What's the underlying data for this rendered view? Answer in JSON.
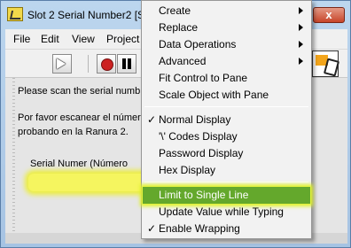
{
  "window": {
    "title": "Slot 2 Serial Number2 [Se",
    "close_symbol": "x"
  },
  "menubar": {
    "items": [
      "File",
      "Edit",
      "View",
      "Project"
    ]
  },
  "toolbar": {
    "icons": [
      "run-arrow-icon",
      "abort-icon",
      "pause-icon",
      "context-help-icon",
      "vi-icon"
    ]
  },
  "panel": {
    "line1": "Please scan the serial numb",
    "line2": "Por favor escanear el númer",
    "line3": "probando en la Ranura 2.",
    "field_label": "Serial Numer (Número"
  },
  "context_menu": {
    "items": [
      {
        "label": "Create",
        "submenu": true,
        "checked": false,
        "highlighted": false
      },
      {
        "label": "Replace",
        "submenu": true,
        "checked": false,
        "highlighted": false
      },
      {
        "label": "Data Operations",
        "submenu": true,
        "checked": false,
        "highlighted": false
      },
      {
        "label": "Advanced",
        "submenu": true,
        "checked": false,
        "highlighted": false
      },
      {
        "label": "Fit Control to Pane",
        "submenu": false,
        "checked": false,
        "highlighted": false
      },
      {
        "label": "Scale Object with Pane",
        "submenu": false,
        "checked": false,
        "highlighted": false
      },
      {
        "label": "Normal Display",
        "submenu": false,
        "checked": true,
        "highlighted": false
      },
      {
        "label": "'\\' Codes Display",
        "submenu": false,
        "checked": false,
        "highlighted": false
      },
      {
        "label": "Password Display",
        "submenu": false,
        "checked": false,
        "highlighted": false
      },
      {
        "label": "Hex Display",
        "submenu": false,
        "checked": false,
        "highlighted": false
      },
      {
        "label": "Limit to Single Line",
        "submenu": false,
        "checked": false,
        "highlighted": true
      },
      {
        "label": "Update Value while Typing",
        "submenu": false,
        "checked": false,
        "highlighted": false
      },
      {
        "label": "Enable Wrapping",
        "submenu": false,
        "checked": true,
        "highlighted": false
      }
    ],
    "check_symbol": "✓"
  },
  "colors": {
    "highlight": "#64a82c",
    "marker_yellow": "#f5f55f"
  }
}
